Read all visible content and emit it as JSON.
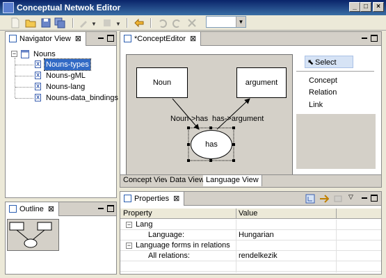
{
  "window": {
    "title": "Conceptual Netwok Editor"
  },
  "navigator": {
    "tab_label": "Navigator View",
    "tree": {
      "root": "Nouns",
      "children": [
        "Nouns-types",
        "Nouns-gML",
        "Nouns-lang",
        "Nouns-data_bindings"
      ]
    }
  },
  "outline": {
    "tab_label": "Outline"
  },
  "editor": {
    "tab_label": "*ConceptEditor",
    "diagram": {
      "nodes": {
        "noun": "Noun",
        "argument": "argument",
        "has": "has"
      },
      "edges": {
        "noun_has": "Noun->has",
        "has_argument": "has->argument"
      }
    },
    "palette": {
      "select": "Select",
      "items": [
        "Concept",
        "Relation",
        "Link"
      ]
    },
    "bottom_tabs": [
      "Concept View",
      "Data View",
      "Language View"
    ]
  },
  "properties": {
    "tab_label": "Properties",
    "columns": [
      "Property",
      "Value"
    ],
    "rows": [
      {
        "name": "Lang",
        "value": ""
      },
      {
        "name": "Language:",
        "value": "Hungarian"
      },
      {
        "name": "Language forms in relations",
        "value": ""
      },
      {
        "name": "All relations:",
        "value": "rendelkezik"
      }
    ]
  },
  "colors": {
    "titlebar": "#0a246a",
    "selection": "#316ac5",
    "background": "#ece9d8"
  }
}
